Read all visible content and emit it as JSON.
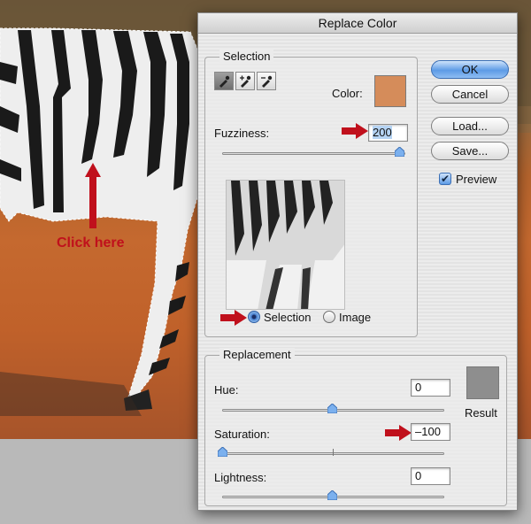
{
  "background": {
    "annotation_label": "Click here"
  },
  "dialog": {
    "title": "Replace Color",
    "buttons": {
      "ok": "OK",
      "cancel": "Cancel",
      "load": "Load...",
      "save": "Save..."
    },
    "preview": {
      "label": "Preview",
      "checked": true
    },
    "selection": {
      "group_label": "Selection",
      "color_label": "Color:",
      "color_hex": "#d58c5a",
      "eyedropper_icons": [
        "eyedropper-icon",
        "eyedropper-plus-icon",
        "eyedropper-minus-icon"
      ],
      "fuzziness_label": "Fuzziness:",
      "fuzziness_value": "200",
      "fuzziness_fraction": 1.0,
      "view_options": [
        {
          "label": "Selection",
          "selected": true
        },
        {
          "label": "Image",
          "selected": false
        }
      ]
    },
    "replacement": {
      "group_label": "Replacement",
      "hue_label": "Hue:",
      "hue_value": "0",
      "saturation_label": "Saturation:",
      "saturation_value": "–100",
      "lightness_label": "Lightness:",
      "lightness_value": "0",
      "result_label": "Result",
      "result_hex": "#8e8e8e"
    }
  }
}
